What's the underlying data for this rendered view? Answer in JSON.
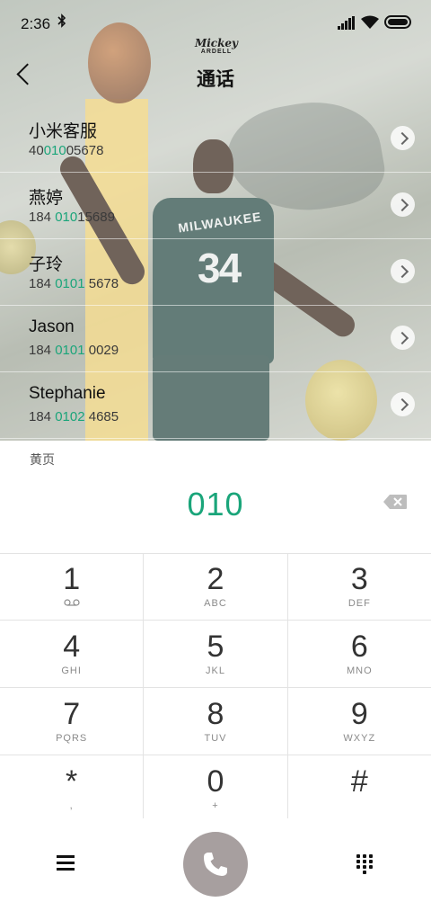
{
  "status": {
    "time": "2:36",
    "bluetooth_icon": "bluetooth-icon"
  },
  "header": {
    "logo_line1": "Mickey",
    "logo_line2": "ARDELL",
    "title": "通话"
  },
  "contacts": [
    {
      "name": "小米客服",
      "num_pre": "40",
      "num_hl": "010",
      "num_post": "05678"
    },
    {
      "name": "燕婷",
      "num_pre": "184 ",
      "num_hl": "010",
      "num_post": "15689"
    },
    {
      "name": "子玲",
      "num_pre": "184 ",
      "num_hl": "0101",
      "num_post": " 5678"
    },
    {
      "name": "Jason",
      "num_pre": "184 ",
      "num_hl": "0101",
      "num_post": " 0029"
    },
    {
      "name": "Stephanie",
      "num_pre": "184 ",
      "num_hl": "0102",
      "num_post": " 4685"
    }
  ],
  "yellow_pages": "黄页",
  "background": {
    "jersey_team": "MILWAUKEE",
    "jersey_number": "34"
  },
  "display": {
    "digits": "010"
  },
  "keypad": [
    [
      {
        "digit": "1",
        "letters": ""
      },
      {
        "digit": "2",
        "letters": "ABC"
      },
      {
        "digit": "3",
        "letters": "DEF"
      }
    ],
    [
      {
        "digit": "4",
        "letters": "GHI"
      },
      {
        "digit": "5",
        "letters": "JKL"
      },
      {
        "digit": "6",
        "letters": "MNO"
      }
    ],
    [
      {
        "digit": "7",
        "letters": "PQRS"
      },
      {
        "digit": "8",
        "letters": "TUV"
      },
      {
        "digit": "9",
        "letters": "WXYZ"
      }
    ],
    [
      {
        "digit": "*",
        "letters": ","
      },
      {
        "digit": "0",
        "letters": "+"
      },
      {
        "digit": "#",
        "letters": ""
      }
    ]
  ],
  "colors": {
    "accent": "#1aa57a",
    "call_button": "#a79f9f"
  }
}
